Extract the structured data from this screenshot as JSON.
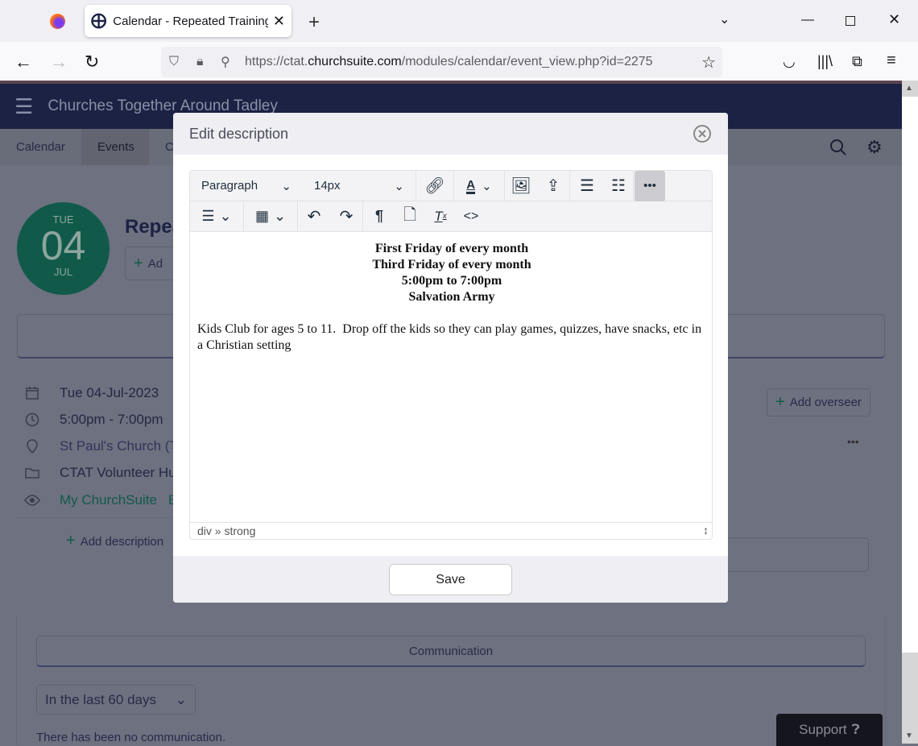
{
  "browser": {
    "tab_title": "Calendar - Repeated Training Ev",
    "url_prefix": "https://ctat.",
    "url_domain": "churchsuite.com",
    "url_path": "/modules/calendar/event_view.php?id=2275"
  },
  "app": {
    "title": "Churches Together Around Tadley",
    "tabs": [
      "Calendar",
      "Events",
      "C"
    ]
  },
  "event": {
    "day": "TUE",
    "date": "04",
    "month": "JUL",
    "title": "Repea",
    "add_button": "Ad",
    "date_text": "Tue 04-Jul-2023",
    "time_text": "5:00pm - 7:00pm",
    "location": "St Paul's Church (T",
    "category": "CTAT Volunteer Hu",
    "visibility": "My ChurchSuite",
    "visibility_extra": "E",
    "add_description": "Add description",
    "add_overseer": "Add overseer"
  },
  "communication": {
    "tab": "Communication",
    "filter": "In the last 60 days",
    "empty": "There has been no communication."
  },
  "support": "Support",
  "modal": {
    "title": "Edit description",
    "block_format": "Paragraph",
    "font_size": "14px",
    "content_centered": [
      "First Friday of every month",
      "Third Friday of every month",
      "5:00pm to 7:00pm",
      "Salvation Army"
    ],
    "content_body": "Kids Club for ages 5 to 11.  Drop off the kids so they can play games, quizzes, have snacks, etc in a Christian setting",
    "status_path": "div » strong",
    "save_label": "Save"
  },
  "colors": {
    "brand_navy": "#1c2244",
    "brand_green": "#115a4a"
  }
}
